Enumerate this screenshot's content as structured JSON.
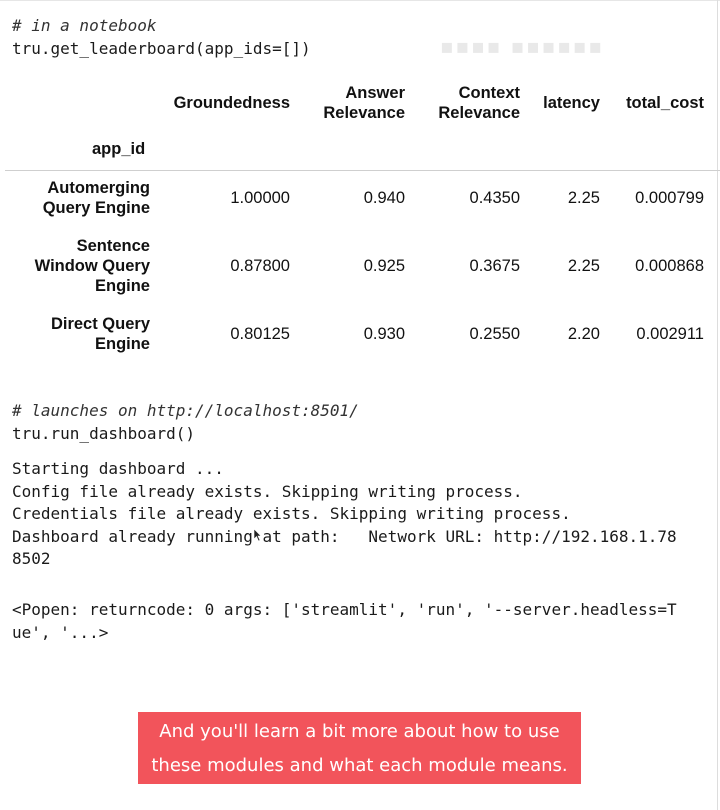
{
  "code": {
    "comment1": "# in a notebook",
    "call1": "tru.get_leaderboard(app_ids=[])",
    "comment2": "# launches on http://localhost:8501/",
    "call2": "tru.run_dashboard()"
  },
  "leaderboard": {
    "columns": {
      "groundedness": "Groundedness",
      "answer_relevance_1": "Answer",
      "answer_relevance_2": "Relevance",
      "context_relevance_1": "Context",
      "context_relevance_2": "Relevance",
      "latency": "latency",
      "total_cost": "total_cost"
    },
    "index_name": "app_id",
    "rows": [
      {
        "app_id_lines": [
          "Automerging",
          "Query Engine"
        ],
        "groundedness": "1.00000",
        "answer_relevance": "0.940",
        "context_relevance": "0.4350",
        "latency": "2.25",
        "total_cost": "0.000799"
      },
      {
        "app_id_lines": [
          "Sentence",
          "Window Query",
          "Engine"
        ],
        "groundedness": "0.87800",
        "answer_relevance": "0.925",
        "context_relevance": "0.3675",
        "latency": "2.25",
        "total_cost": "0.000868"
      },
      {
        "app_id_lines": [
          "Direct Query",
          "Engine"
        ],
        "groundedness": "0.80125",
        "answer_relevance": "0.930",
        "context_relevance": "0.2550",
        "latency": "2.20",
        "total_cost": "0.002911"
      }
    ]
  },
  "output": {
    "lines": [
      "Starting dashboard ...",
      "Config file already exists. Skipping writing process.",
      "Credentials file already exists. Skipping writing process.",
      "Dashboard already running at path:   Network URL: http://192.168.1.78",
      "8502"
    ],
    "popen_lines": [
      "<Popen: returncode: 0 args: ['streamlit', 'run', '--server.headless=T",
      "ue', '...>"
    ]
  },
  "subtitle": {
    "line1": "And you'll learn a bit more about how to use",
    "line2": "these modules and what each module means."
  },
  "colors": {
    "subtitle_bg": "#f2545b",
    "text": "#1a1a1a"
  },
  "icons": {
    "cursor": "text-cursor-icon"
  }
}
